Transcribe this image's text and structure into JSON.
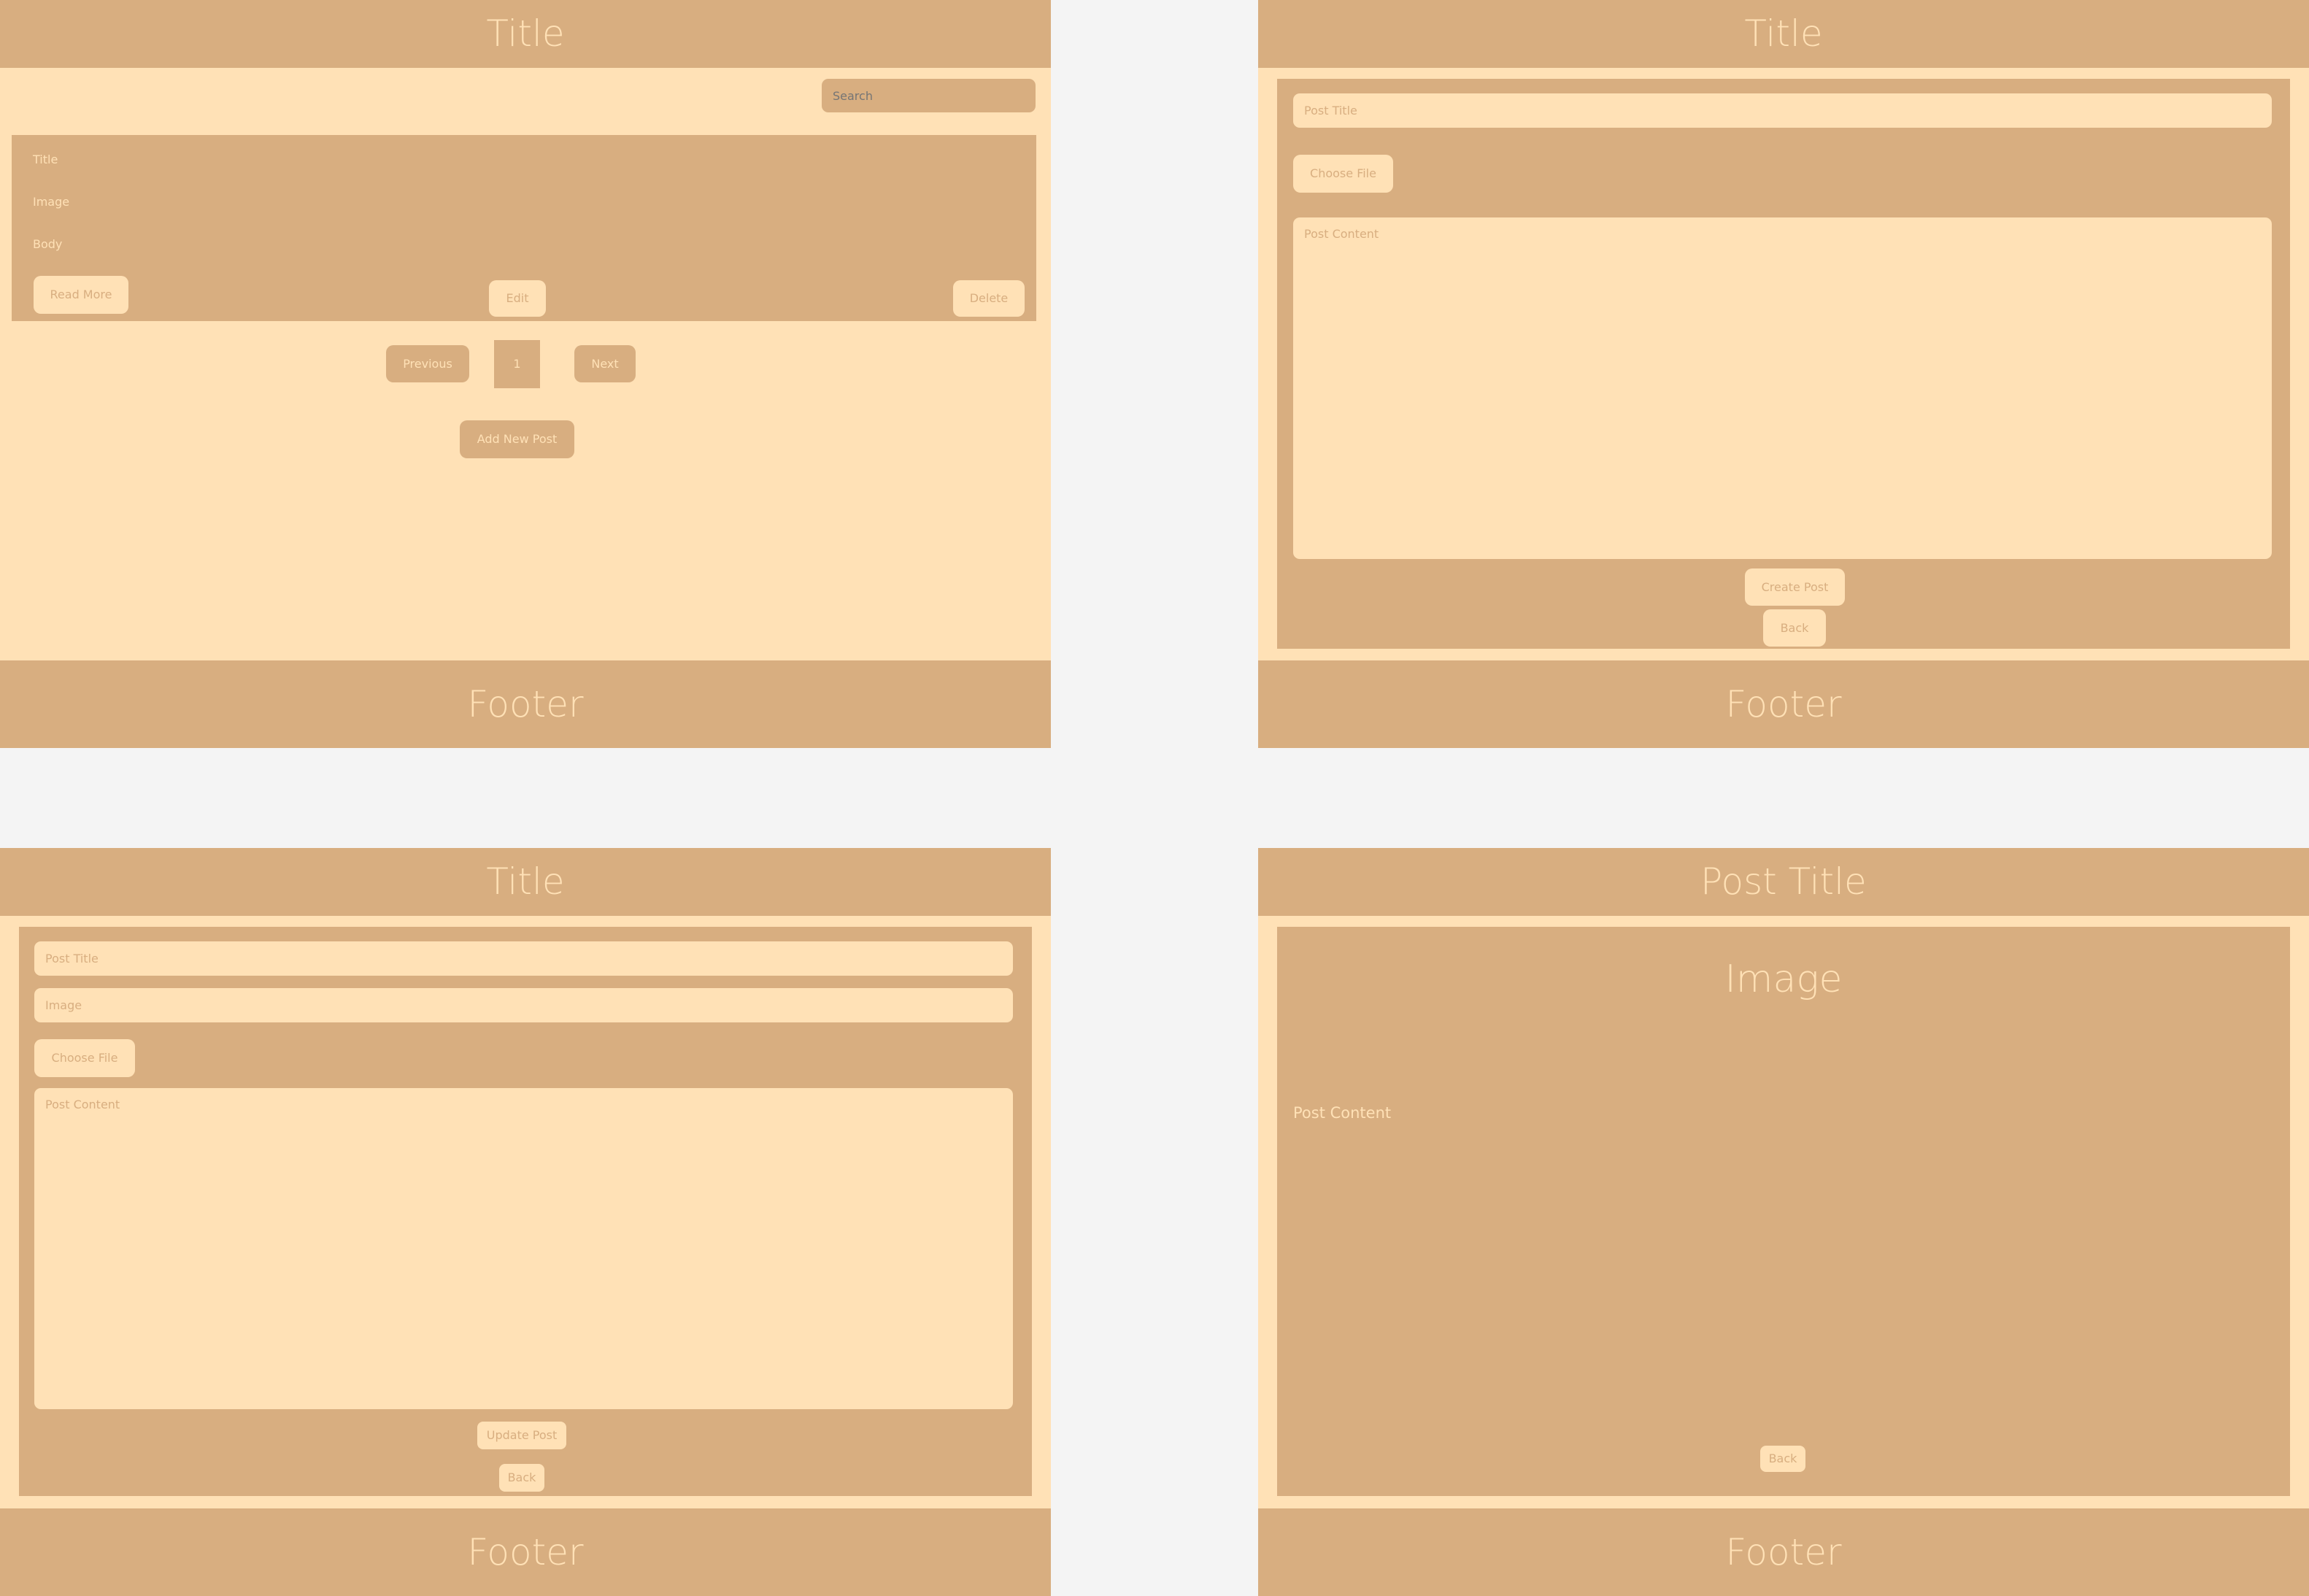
{
  "colors": {
    "background": "#f4f4f4",
    "surface": "#ffe1b6",
    "accent": "#d8ae80"
  },
  "list_screen": {
    "title": "Title",
    "search_placeholder": "Search",
    "card": {
      "title": "Title",
      "image": "Image",
      "body": "Body",
      "read_more": "Read More",
      "edit": "Edit",
      "delete": "Delete"
    },
    "pagination": {
      "previous": "Previous",
      "page": "1",
      "next": "Next"
    },
    "add_new_post": "Add New Post",
    "footer": "Footer"
  },
  "create_screen": {
    "title": "Title",
    "post_title_placeholder": "Post Title",
    "choose_file": "Choose File",
    "post_content_placeholder": "Post Content",
    "create_post": "Create Post",
    "back": "Back",
    "footer": "Footer"
  },
  "edit_screen": {
    "title": "Title",
    "post_title_placeholder": "Post Title",
    "image_placeholder": "Image",
    "choose_file": "Choose File",
    "post_content_placeholder": "Post Content",
    "update_post": "Update Post",
    "back": "Back",
    "footer": "Footer"
  },
  "detail_screen": {
    "title": "Post Title",
    "image": "Image",
    "post_content": "Post Content",
    "back": "Back",
    "footer": "Footer"
  }
}
